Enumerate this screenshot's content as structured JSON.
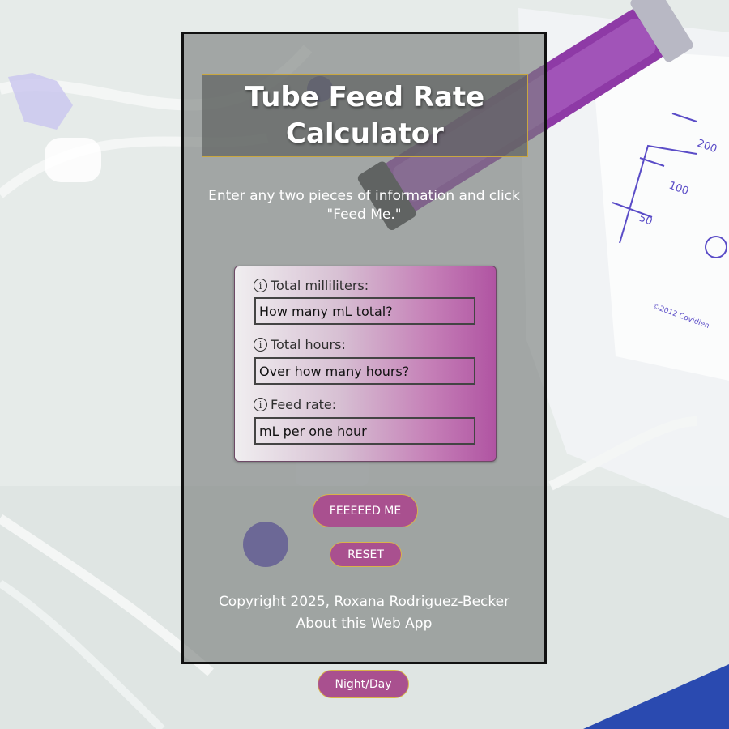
{
  "title": "Tube Feed Rate Calculator",
  "instructions": "Enter any two pieces of information and click \"Feed Me.\"",
  "form": {
    "fields": [
      {
        "label": "Total milliliters:",
        "placeholder": "How many mL total?"
      },
      {
        "label": "Total hours:",
        "placeholder": "Over how many hours?"
      },
      {
        "label": "Feed rate:",
        "placeholder": "mL per one hour"
      }
    ]
  },
  "buttons": {
    "feed": "FEEEEED ME",
    "reset": "RESET",
    "night_day": "Night/Day"
  },
  "footer": {
    "copyright": "Copyright 2025, Roxana Rodriguez-Becker",
    "about_link": "About",
    "about_suffix": " this Web App"
  },
  "colors": {
    "button_bg": "#a9508f",
    "button_border": "#d9b34a",
    "card_gradient_end": "#b054a2"
  },
  "icons": {
    "field_info": "info-icon"
  }
}
